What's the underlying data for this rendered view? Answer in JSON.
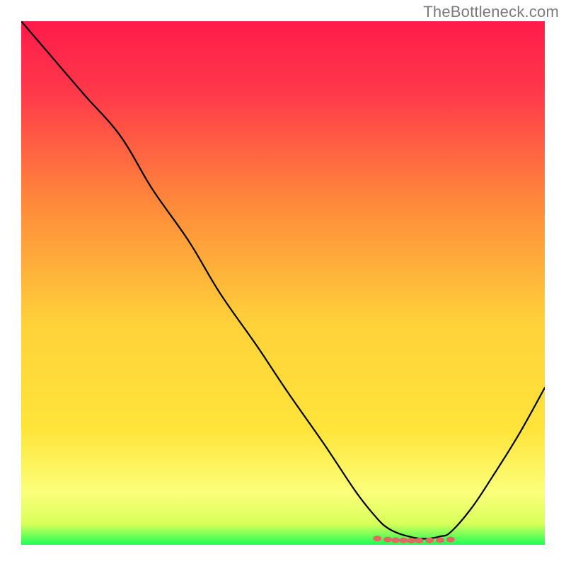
{
  "watermark": "TheBottleneck.com",
  "chart_data": {
    "type": "line",
    "title": "",
    "xlabel": "",
    "ylabel": "",
    "xlim": [
      0,
      100
    ],
    "ylim": [
      0,
      100
    ],
    "grid": false,
    "legend": false,
    "background_gradient": {
      "top_color": "#ff1a4a",
      "mid_color": "#ffd23a",
      "lower_color": "#fbff7a",
      "bottom_color": "#1eff55"
    },
    "series": [
      {
        "name": "bottleneck-curve",
        "color": "#000000",
        "x": [
          0,
          6,
          12,
          19,
          25,
          32,
          38,
          45,
          51,
          58,
          64,
          68,
          70,
          72,
          74,
          76,
          78,
          80,
          82,
          86,
          90,
          95,
          100
        ],
        "y": [
          100,
          93,
          86,
          78,
          68,
          58,
          48,
          38,
          29,
          19,
          10,
          5,
          3.2,
          2.2,
          1.6,
          1.2,
          1.2,
          1.6,
          2.4,
          7,
          13,
          21,
          30
        ]
      },
      {
        "name": "optimal-range-markers",
        "color": "#e06a62",
        "type": "scatter",
        "x": [
          68,
          70,
          71.5,
          73,
          74.5,
          76,
          78,
          80,
          82
        ],
        "y": [
          1.2,
          1.0,
          0.9,
          0.85,
          0.8,
          0.8,
          0.85,
          0.9,
          1.0
        ]
      }
    ]
  }
}
